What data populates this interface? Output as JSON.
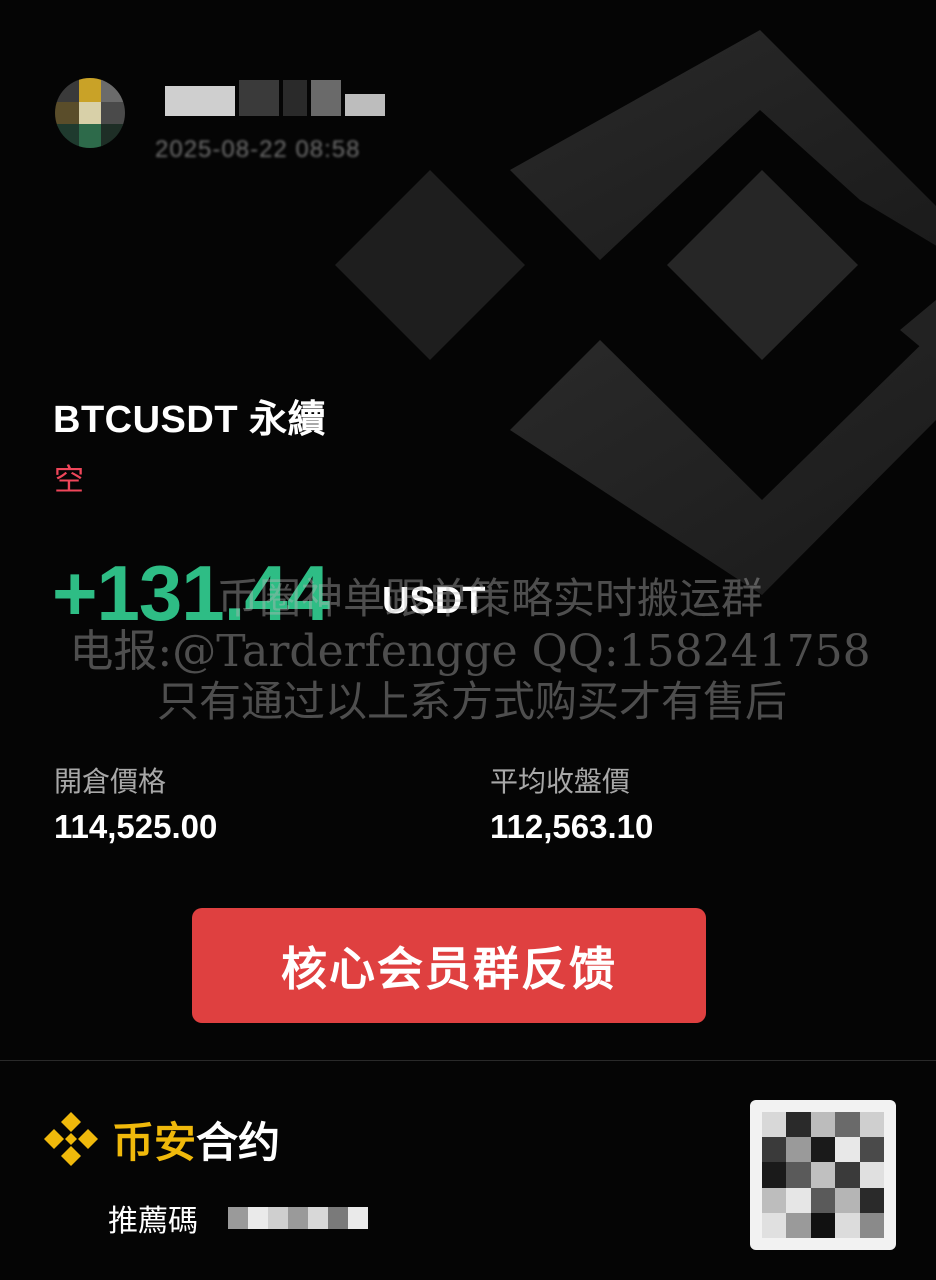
{
  "header": {
    "username": "",
    "timestamp": "2025-08-22 08:58"
  },
  "trade": {
    "pair": "BTCUSDT 永續",
    "side": "空",
    "pnl": "+131.44",
    "pnl_unit": "USDT",
    "open_price_label": "開倉價格",
    "open_price": "114,525.00",
    "close_price_label": "平均收盤價",
    "close_price": "112,563.10"
  },
  "watermark": {
    "line1": "币圈神单跟单策略实时搬运群",
    "line2": "电报:@Tarderfengge QQ:158241758",
    "line3": "只有通过以上系方式购买才有售后"
  },
  "cta": {
    "label": "核心会员群反馈"
  },
  "footer": {
    "brand_part1": "币安",
    "brand_part2": "合约",
    "referral_label": "推薦碼",
    "referral_code": ""
  },
  "colors": {
    "background": "#050505",
    "profit": "#2ebd85",
    "short": "#f0465a",
    "button": "#df4040",
    "brand": "#f0b90b"
  },
  "icons": [
    "binance-logo-icon",
    "binance-background-logo-icon",
    "qr-code-icon",
    "avatar"
  ]
}
